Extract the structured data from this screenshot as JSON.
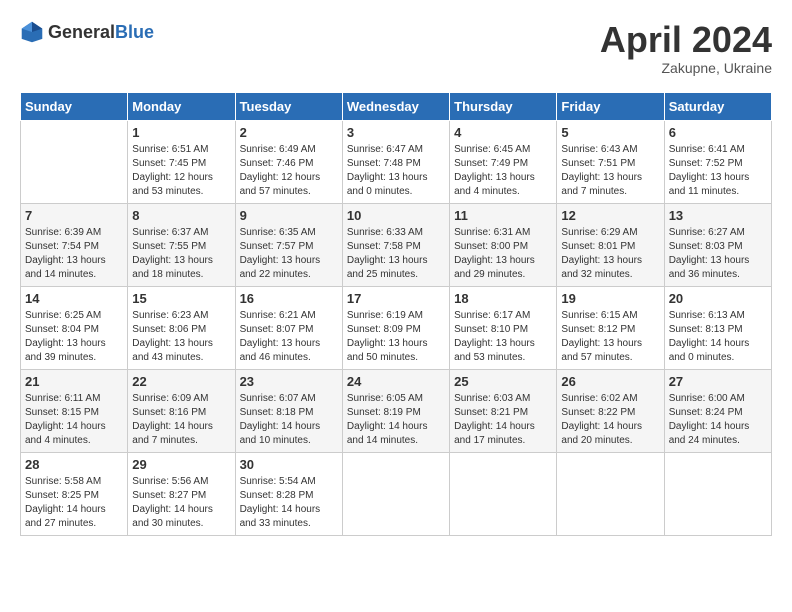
{
  "header": {
    "logo_general": "General",
    "logo_blue": "Blue",
    "month_title": "April 2024",
    "subtitle": "Zakupne, Ukraine"
  },
  "days_of_week": [
    "Sunday",
    "Monday",
    "Tuesday",
    "Wednesday",
    "Thursday",
    "Friday",
    "Saturday"
  ],
  "weeks": [
    [
      {
        "day": "",
        "sunrise": "",
        "sunset": "",
        "daylight": ""
      },
      {
        "day": "1",
        "sunrise": "Sunrise: 6:51 AM",
        "sunset": "Sunset: 7:45 PM",
        "daylight": "Daylight: 12 hours and 53 minutes."
      },
      {
        "day": "2",
        "sunrise": "Sunrise: 6:49 AM",
        "sunset": "Sunset: 7:46 PM",
        "daylight": "Daylight: 12 hours and 57 minutes."
      },
      {
        "day": "3",
        "sunrise": "Sunrise: 6:47 AM",
        "sunset": "Sunset: 7:48 PM",
        "daylight": "Daylight: 13 hours and 0 minutes."
      },
      {
        "day": "4",
        "sunrise": "Sunrise: 6:45 AM",
        "sunset": "Sunset: 7:49 PM",
        "daylight": "Daylight: 13 hours and 4 minutes."
      },
      {
        "day": "5",
        "sunrise": "Sunrise: 6:43 AM",
        "sunset": "Sunset: 7:51 PM",
        "daylight": "Daylight: 13 hours and 7 minutes."
      },
      {
        "day": "6",
        "sunrise": "Sunrise: 6:41 AM",
        "sunset": "Sunset: 7:52 PM",
        "daylight": "Daylight: 13 hours and 11 minutes."
      }
    ],
    [
      {
        "day": "7",
        "sunrise": "Sunrise: 6:39 AM",
        "sunset": "Sunset: 7:54 PM",
        "daylight": "Daylight: 13 hours and 14 minutes."
      },
      {
        "day": "8",
        "sunrise": "Sunrise: 6:37 AM",
        "sunset": "Sunset: 7:55 PM",
        "daylight": "Daylight: 13 hours and 18 minutes."
      },
      {
        "day": "9",
        "sunrise": "Sunrise: 6:35 AM",
        "sunset": "Sunset: 7:57 PM",
        "daylight": "Daylight: 13 hours and 22 minutes."
      },
      {
        "day": "10",
        "sunrise": "Sunrise: 6:33 AM",
        "sunset": "Sunset: 7:58 PM",
        "daylight": "Daylight: 13 hours and 25 minutes."
      },
      {
        "day": "11",
        "sunrise": "Sunrise: 6:31 AM",
        "sunset": "Sunset: 8:00 PM",
        "daylight": "Daylight: 13 hours and 29 minutes."
      },
      {
        "day": "12",
        "sunrise": "Sunrise: 6:29 AM",
        "sunset": "Sunset: 8:01 PM",
        "daylight": "Daylight: 13 hours and 32 minutes."
      },
      {
        "day": "13",
        "sunrise": "Sunrise: 6:27 AM",
        "sunset": "Sunset: 8:03 PM",
        "daylight": "Daylight: 13 hours and 36 minutes."
      }
    ],
    [
      {
        "day": "14",
        "sunrise": "Sunrise: 6:25 AM",
        "sunset": "Sunset: 8:04 PM",
        "daylight": "Daylight: 13 hours and 39 minutes."
      },
      {
        "day": "15",
        "sunrise": "Sunrise: 6:23 AM",
        "sunset": "Sunset: 8:06 PM",
        "daylight": "Daylight: 13 hours and 43 minutes."
      },
      {
        "day": "16",
        "sunrise": "Sunrise: 6:21 AM",
        "sunset": "Sunset: 8:07 PM",
        "daylight": "Daylight: 13 hours and 46 minutes."
      },
      {
        "day": "17",
        "sunrise": "Sunrise: 6:19 AM",
        "sunset": "Sunset: 8:09 PM",
        "daylight": "Daylight: 13 hours and 50 minutes."
      },
      {
        "day": "18",
        "sunrise": "Sunrise: 6:17 AM",
        "sunset": "Sunset: 8:10 PM",
        "daylight": "Daylight: 13 hours and 53 minutes."
      },
      {
        "day": "19",
        "sunrise": "Sunrise: 6:15 AM",
        "sunset": "Sunset: 8:12 PM",
        "daylight": "Daylight: 13 hours and 57 minutes."
      },
      {
        "day": "20",
        "sunrise": "Sunrise: 6:13 AM",
        "sunset": "Sunset: 8:13 PM",
        "daylight": "Daylight: 14 hours and 0 minutes."
      }
    ],
    [
      {
        "day": "21",
        "sunrise": "Sunrise: 6:11 AM",
        "sunset": "Sunset: 8:15 PM",
        "daylight": "Daylight: 14 hours and 4 minutes."
      },
      {
        "day": "22",
        "sunrise": "Sunrise: 6:09 AM",
        "sunset": "Sunset: 8:16 PM",
        "daylight": "Daylight: 14 hours and 7 minutes."
      },
      {
        "day": "23",
        "sunrise": "Sunrise: 6:07 AM",
        "sunset": "Sunset: 8:18 PM",
        "daylight": "Daylight: 14 hours and 10 minutes."
      },
      {
        "day": "24",
        "sunrise": "Sunrise: 6:05 AM",
        "sunset": "Sunset: 8:19 PM",
        "daylight": "Daylight: 14 hours and 14 minutes."
      },
      {
        "day": "25",
        "sunrise": "Sunrise: 6:03 AM",
        "sunset": "Sunset: 8:21 PM",
        "daylight": "Daylight: 14 hours and 17 minutes."
      },
      {
        "day": "26",
        "sunrise": "Sunrise: 6:02 AM",
        "sunset": "Sunset: 8:22 PM",
        "daylight": "Daylight: 14 hours and 20 minutes."
      },
      {
        "day": "27",
        "sunrise": "Sunrise: 6:00 AM",
        "sunset": "Sunset: 8:24 PM",
        "daylight": "Daylight: 14 hours and 24 minutes."
      }
    ],
    [
      {
        "day": "28",
        "sunrise": "Sunrise: 5:58 AM",
        "sunset": "Sunset: 8:25 PM",
        "daylight": "Daylight: 14 hours and 27 minutes."
      },
      {
        "day": "29",
        "sunrise": "Sunrise: 5:56 AM",
        "sunset": "Sunset: 8:27 PM",
        "daylight": "Daylight: 14 hours and 30 minutes."
      },
      {
        "day": "30",
        "sunrise": "Sunrise: 5:54 AM",
        "sunset": "Sunset: 8:28 PM",
        "daylight": "Daylight: 14 hours and 33 minutes."
      },
      {
        "day": "",
        "sunrise": "",
        "sunset": "",
        "daylight": ""
      },
      {
        "day": "",
        "sunrise": "",
        "sunset": "",
        "daylight": ""
      },
      {
        "day": "",
        "sunrise": "",
        "sunset": "",
        "daylight": ""
      },
      {
        "day": "",
        "sunrise": "",
        "sunset": "",
        "daylight": ""
      }
    ]
  ]
}
